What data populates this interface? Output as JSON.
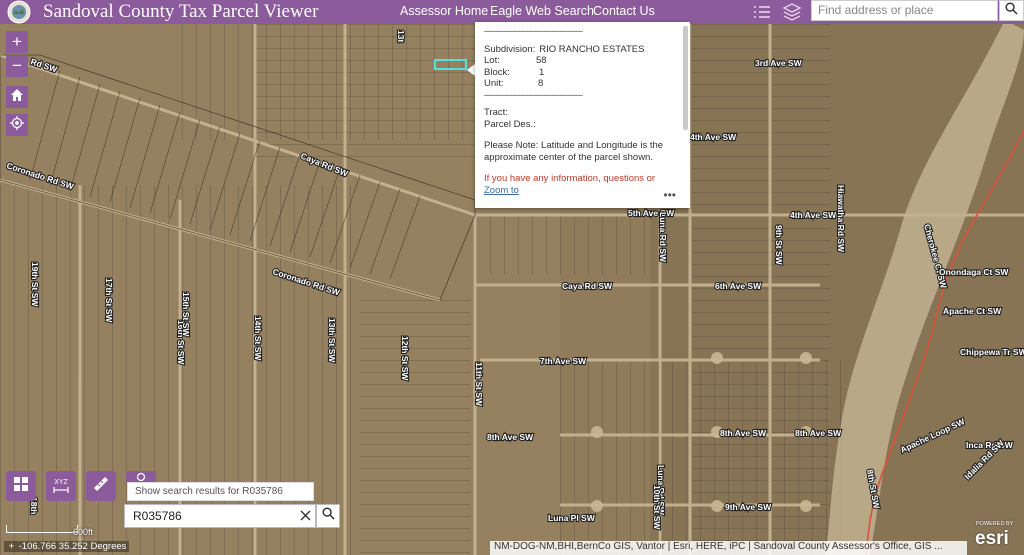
{
  "header": {
    "title": "Sandoval County Tax Parcel Viewer",
    "nav": [
      "Assessor Home",
      "Eagle Web Search",
      "Contact Us"
    ],
    "search_placeholder": "Find address or place"
  },
  "colors": {
    "brand": "#8c5b9c",
    "highlight": "#55e0e0"
  },
  "icons": [
    "list-icon",
    "layers-icon",
    "search-icon",
    "zoom-in-icon",
    "zoom-out-icon",
    "home-icon",
    "locate-icon",
    "grid-icon",
    "xyz-icon",
    "measure-icon",
    "clear-icon"
  ],
  "map_controls": {
    "zoom_in": "+",
    "zoom_out": "−"
  },
  "popup": {
    "separator": "-------------------------------------",
    "subdivision_label": "Subdivision:",
    "subdivision": "RIO RANCHO ESTATES",
    "lot_label": "Lot:",
    "lot": "58",
    "block_label": "Block:",
    "block": "1",
    "unit_label": "Unit:",
    "unit": "8",
    "separator2": "-------------------------------------",
    "tract_label": "Tract:",
    "parcel_des_label": "Parcel Des.:",
    "note": "Please Note: Latitude and Longitude is the approximate center of the parcel shown.",
    "info_text": "If you have any information, questions or",
    "zoom_to": "Zoom to",
    "more": "•••"
  },
  "widgets": {
    "xyz_label": "XYZ",
    "results_tip": "Show search results for R035786",
    "search_value": "R035786"
  },
  "status": {
    "scale_label": "600ft",
    "coords": "-106.766 35.252 Degrees",
    "attribution": "NM-DOG-NM,BHI,BernCo GIS, Vantor | Esri, HERE, iPC | Sandoval County Assessor's Office, GIS ...",
    "esri_powered": "POWERED BY",
    "esri": "esri"
  },
  "street_labels": [
    "Rd SW",
    "Caya Rd SW",
    "Coronado Rd SW",
    "Coronado Rd SW",
    "5th Ave SW",
    "6th Ave SW",
    "7th Ave SW",
    "8th Ave SW",
    "8th Ave SW",
    "8th Ave SW",
    "9th Ave SW",
    "3rd Ave SW",
    "4th Ave SW",
    "4th Ave SW",
    "Caya Rd SW",
    "Luna Pl SW",
    "Luna Rd SW",
    "Luna Rd SW",
    "19th St SW",
    "17th St SW",
    "16th St SW",
    "15th St SW",
    "14th St SW",
    "13th St SW",
    "12th St SW",
    "11th St SW",
    "10th St SW",
    "9th St SW",
    "18th",
    "Apache Ct SW",
    "Apache Loop SW",
    "Chippewa Tr SW",
    "Inca Rd SW",
    "Idalia Rd SW",
    "Cherokee Ct SW",
    "Onondaga Ct SW",
    "Hiawatha Rd SW",
    "8th St SW",
    "13t"
  ]
}
